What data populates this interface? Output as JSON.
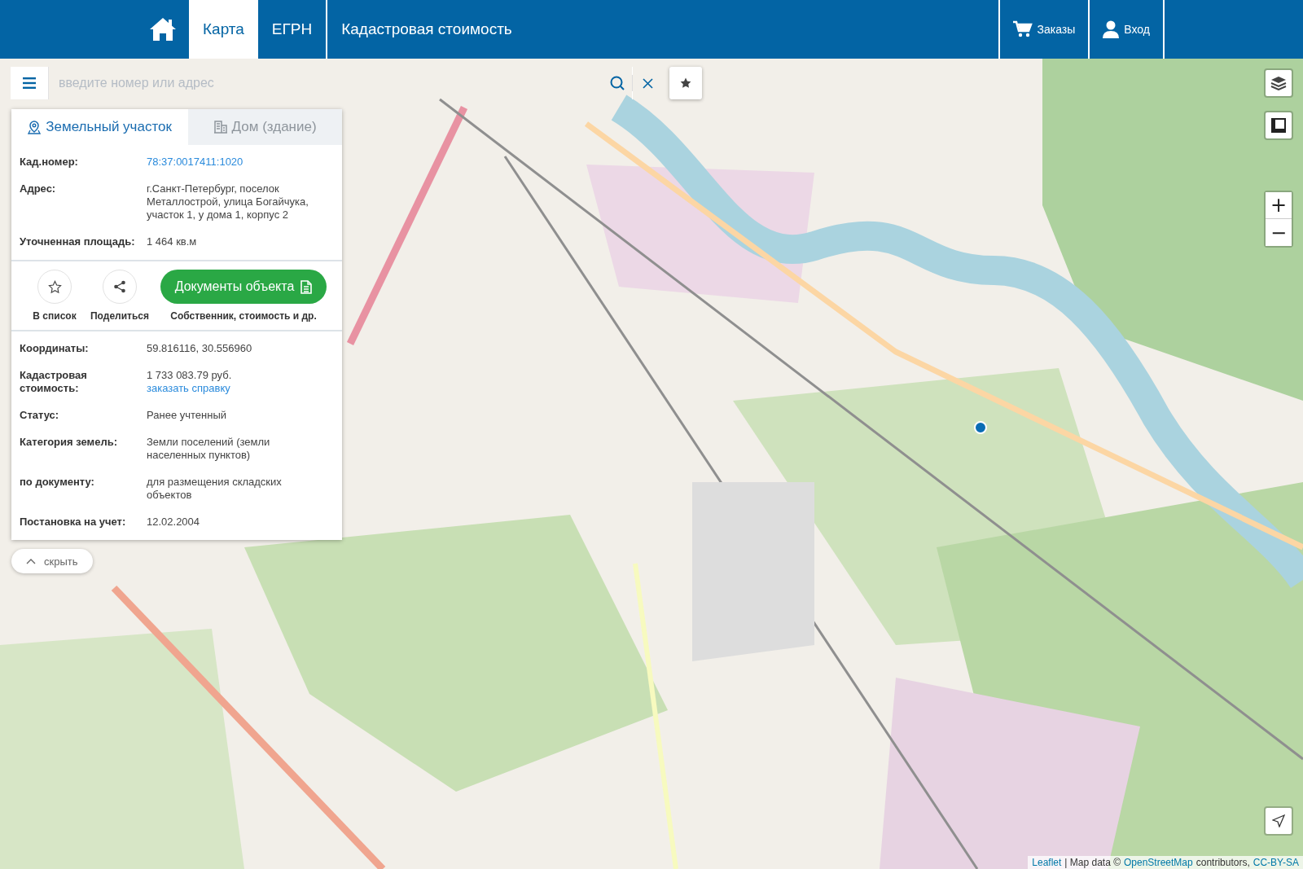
{
  "header": {
    "nav": [
      {
        "label": "Карта",
        "selected": true
      },
      {
        "label": "ЕГРН",
        "selected": false
      },
      {
        "label": "Кадастровая стоимость",
        "selected": false
      }
    ],
    "actions": [
      {
        "label": "Заказы",
        "kind": "cart"
      },
      {
        "label": "Вход",
        "kind": "user"
      }
    ]
  },
  "search": {
    "placeholder": "введите номер или адрес"
  },
  "panel": {
    "tabs": [
      {
        "label": "Земельный участок",
        "kind": "land",
        "selected": true
      },
      {
        "label": "Дом (здание)",
        "kind": "building",
        "selected": false
      }
    ],
    "top_rows": [
      {
        "label": "Кад.номер:",
        "value": "78:37:0017411:1020",
        "kind": "link"
      },
      {
        "label": "Адрес:",
        "value": "г.Санкт-Петербург, поселок Металлострой, улица Богайчука, участок 1, у дома 1, корпус 2",
        "kind": "text"
      },
      {
        "label": "Уточненная площадь:",
        "value": "1 464 кв.м",
        "kind": "text"
      }
    ],
    "actions": [
      {
        "label": "В список",
        "kind": "star"
      },
      {
        "label": "Поделиться",
        "kind": "share"
      }
    ],
    "documents_button": {
      "label": "Документы объекта",
      "caption": "Собственник, стоимость и др."
    },
    "details": [
      {
        "label": "Координаты:",
        "value": "59.816116, 30.556960"
      },
      {
        "label": "Кадастровая стоимость:",
        "value": "1 733 083.79 руб.",
        "link": "заказать справку"
      },
      {
        "label": "Статус:",
        "value": "Ранее учтенный"
      },
      {
        "label": "Категория земель:",
        "value": "Земли поселений (земли населенных пунктов)"
      },
      {
        "label": "по документу:",
        "value": "для размещения складских объектов"
      },
      {
        "label": "Постановка на учет:",
        "value": "12.02.2004"
      }
    ]
  },
  "hide_button": {
    "label": "скрыть"
  },
  "zoom": {
    "in": "+",
    "out": "−"
  },
  "attribution": [
    {
      "text": "Leaflet",
      "kind": "link"
    },
    {
      "text": "| Map data ©",
      "kind": "text"
    },
    {
      "text": "OpenStreetMap",
      "kind": "link"
    },
    {
      "text": "contributors,",
      "kind": "text"
    },
    {
      "text": "CC-BY-SA",
      "kind": "link"
    }
  ]
}
